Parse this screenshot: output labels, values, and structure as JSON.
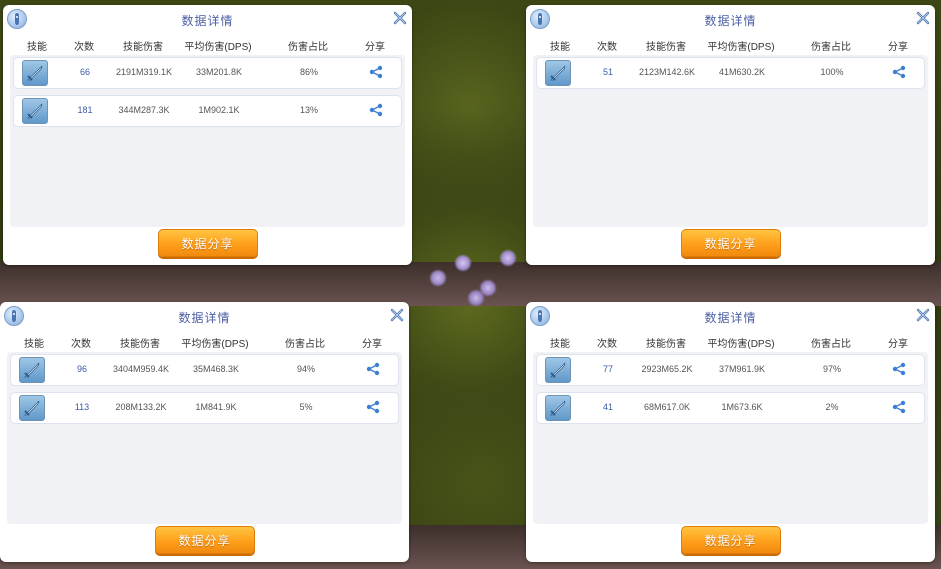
{
  "common": {
    "title": "数据详情",
    "share_button": "数据分享",
    "columns": {
      "skill": "技能",
      "count": "次数",
      "damage": "技能伤害",
      "dps": "平均伤害(DPS)",
      "ratio": "伤害占比",
      "share": "分享"
    }
  },
  "panels": [
    {
      "rows": [
        {
          "count": "66",
          "damage": "2191M319.1K",
          "dps": "33M201.8K",
          "ratio": "86%"
        },
        {
          "count": "181",
          "damage": "344M287.3K",
          "dps": "1M902.1K",
          "ratio": "13%"
        }
      ]
    },
    {
      "rows": [
        {
          "count": "51",
          "damage": "2123M142.6K",
          "dps": "41M630.2K",
          "ratio": "100%"
        }
      ]
    },
    {
      "rows": [
        {
          "count": "96",
          "damage": "3404M959.4K",
          "dps": "35M468.3K",
          "ratio": "94%"
        },
        {
          "count": "113",
          "damage": "208M133.2K",
          "dps": "1M841.9K",
          "ratio": "5%"
        }
      ]
    },
    {
      "rows": [
        {
          "count": "77",
          "damage": "2923M65.2K",
          "dps": "37M961.9K",
          "ratio": "97%"
        },
        {
          "count": "41",
          "damage": "68M617.0K",
          "dps": "1M673.6K",
          "ratio": "2%"
        }
      ]
    }
  ],
  "icons": {
    "info": "info-icon",
    "close": "close-icon",
    "skill": "skill-sword-icon",
    "share": "share-icon"
  },
  "colors": {
    "accent": "#4b5fa3",
    "button": "#ff9f1a",
    "share_icon": "#3d7fd1"
  }
}
